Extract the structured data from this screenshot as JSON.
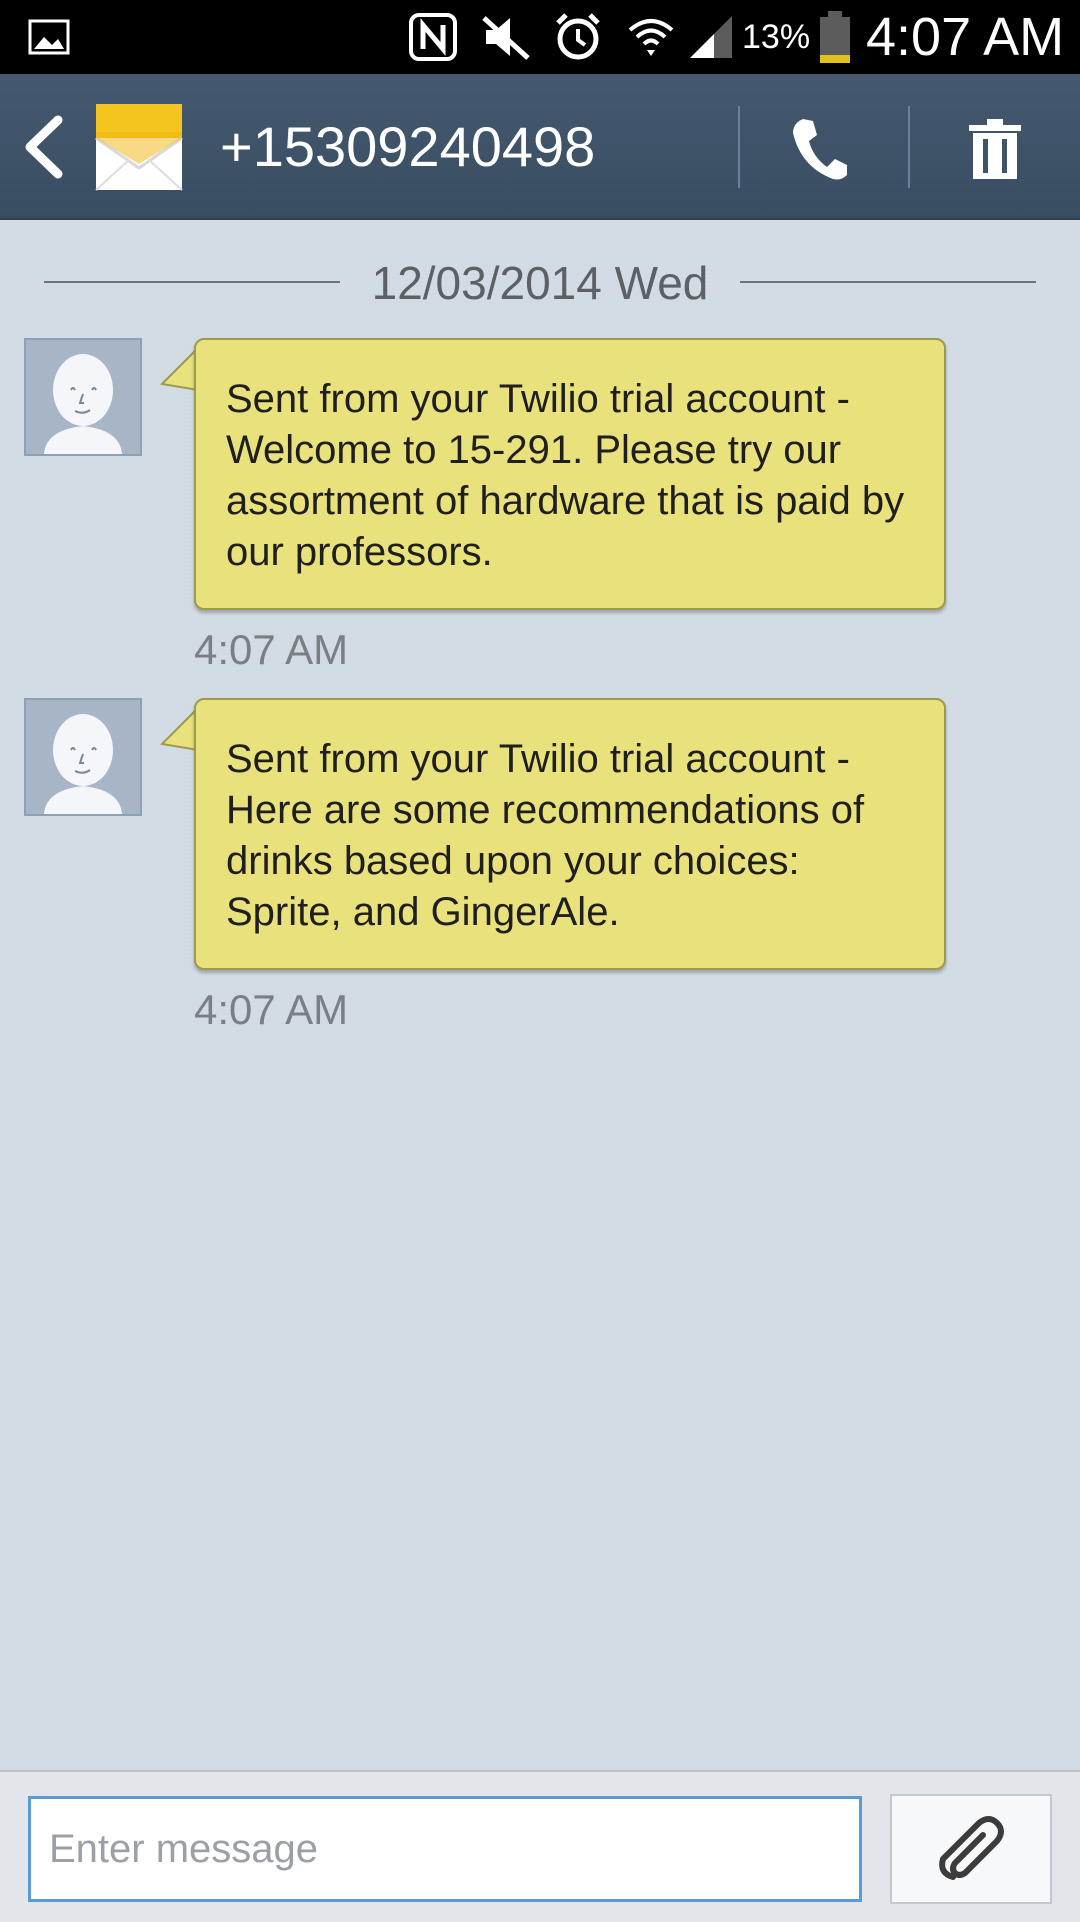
{
  "status_bar": {
    "battery_percent": "13%",
    "time": "4:07 AM",
    "icons": [
      "gallery-icon",
      "nfc-icon",
      "mute-icon",
      "alarm-icon",
      "wifi-icon",
      "signal-icon",
      "battery-icon"
    ]
  },
  "header": {
    "contact_number": "+15309240498",
    "icons": [
      "back-icon",
      "envelope-icon",
      "phone-icon",
      "trash-icon"
    ]
  },
  "conversation": {
    "date": "12/03/2014 Wed",
    "messages": [
      {
        "text": "Sent from your Twilio trial account - Welcome to 15-291. Please try our assortment of hardware that is paid by our professors.",
        "time": "4:07 AM"
      },
      {
        "text": "Sent from your Twilio trial account - Here are some recommendations of drinks based upon your choices: Sprite, and GingerAle.",
        "time": "4:07 AM"
      }
    ]
  },
  "composer": {
    "placeholder": "Enter message",
    "value": "",
    "attach_icon": "paperclip-icon"
  },
  "colors": {
    "action_bar": "#3f5469",
    "bubble": "#e8e17c",
    "background": "#d3dce5",
    "input_border": "#5a9bd4"
  }
}
